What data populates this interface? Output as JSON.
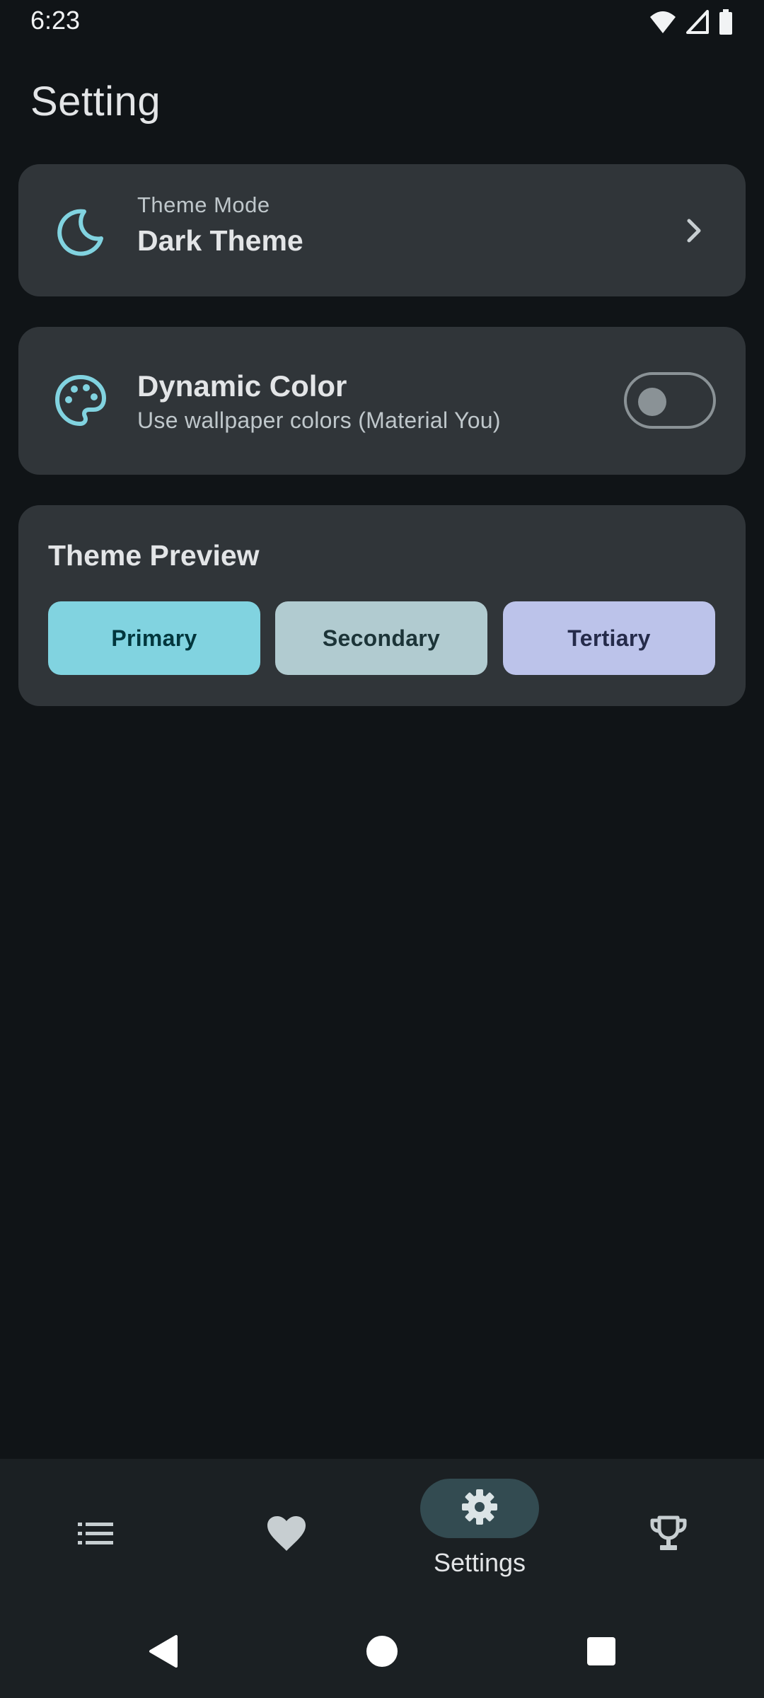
{
  "status_bar": {
    "time": "6:23",
    "icons": [
      "wifi-icon",
      "signal-icon",
      "battery-icon"
    ]
  },
  "page": {
    "title": "Setting"
  },
  "theme_mode": {
    "icon": "moon-icon",
    "label": "Theme Mode",
    "value": "Dark Theme",
    "action_icon": "chevron-right-icon"
  },
  "dynamic_color": {
    "icon": "palette-icon",
    "title": "Dynamic Color",
    "subtitle": "Use wallpaper colors (Material You)",
    "enabled": false
  },
  "theme_preview": {
    "title": "Theme Preview",
    "swatches": [
      {
        "label": "Primary",
        "color": "#81d3e0"
      },
      {
        "label": "Secondary",
        "color": "#b1cbd0"
      },
      {
        "label": "Tertiary",
        "color": "#bcc3ea"
      }
    ]
  },
  "bottom_nav": {
    "items": [
      {
        "icon": "list-icon",
        "label": ""
      },
      {
        "icon": "heart-icon",
        "label": ""
      },
      {
        "icon": "gear-icon",
        "label": "Settings",
        "selected": true
      },
      {
        "icon": "trophy-icon",
        "label": ""
      }
    ]
  },
  "system_nav": {
    "buttons": [
      "back-icon",
      "home-icon",
      "recents-icon"
    ]
  },
  "colors": {
    "background": "#101417",
    "card": "#303539",
    "accent": "#81d3e0",
    "nav_background": "#1b2023",
    "nav_indicator": "#334b51"
  }
}
